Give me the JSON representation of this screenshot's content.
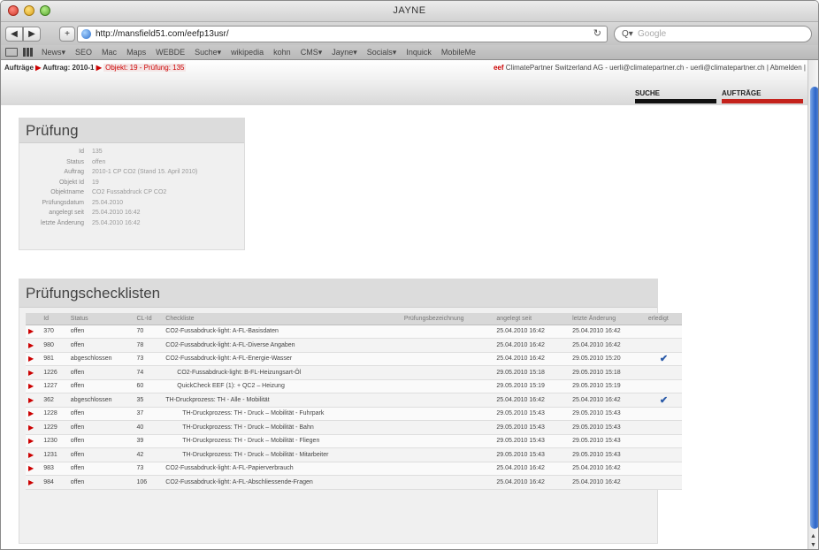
{
  "window": {
    "title": "JAYNE"
  },
  "browser": {
    "back_label": "◀",
    "forward_label": "▶",
    "add_label": "+",
    "url": "http://mansfield51.com/eefp13usr/",
    "reload_label": "↻",
    "search_placeholder": "Google",
    "search_icon": "Q▾",
    "bookmarks": [
      "News▾",
      "SEO",
      "Mac",
      "Maps",
      "WEBDE",
      "Suche▾",
      "wikipedia",
      "kohn",
      "CMS▾",
      "Jayne▾",
      "Socials▾",
      "Inquick",
      "MobileMe"
    ]
  },
  "header": {
    "crumb1": "Aufträge",
    "crumb2": "Auftrag: 2010-1",
    "crumb3": "Objekt: 19 - Prüfung: 135",
    "user_prefix": "eef",
    "user_text": "ClimatePartner Switzerland AG - uerli@climatepartner.ch - uerli@climatepartner.ch",
    "logout": "| Abmelden |",
    "nav_suche": "SUCHE",
    "nav_auftraege": "AUFTRÄGE"
  },
  "pruefung": {
    "title": "Prüfung",
    "rows": [
      {
        "label": "Id",
        "value": "135"
      },
      {
        "label": "Status",
        "value": "offen"
      },
      {
        "label": "Auftrag",
        "value": "2010-1  CP CO2 (Stand 15. April 2010)"
      },
      {
        "label": "Objekt Id",
        "value": "19"
      },
      {
        "label": "Objektname",
        "value": "CO2 Fussabdruck CP CO2"
      },
      {
        "label": "Prüfungsdatum",
        "value": "25.04.2010"
      },
      {
        "label": "angelegt seit",
        "value": "25.04.2010 16:42"
      },
      {
        "label": "letzte Änderung",
        "value": "25.04.2010 16:42"
      }
    ]
  },
  "checklists": {
    "title": "Prüfungschecklisten",
    "columns": [
      "",
      "Id",
      "Status",
      "CL-Id",
      "Checkliste",
      "Prüfungsbezeichnung",
      "angelegt seit",
      "letzte Änderung",
      "erledigt"
    ],
    "rows": [
      {
        "id": "370",
        "status": "offen",
        "clid": "70",
        "name": "CO2-Fussabdruck-light: A-FL-Basisdaten",
        "indent": 0,
        "created": "25.04.2010 16:42",
        "changed": "25.04.2010 16:42",
        "done": ""
      },
      {
        "id": "980",
        "status": "offen",
        "clid": "78",
        "name": "CO2-Fussabdruck-light: A-FL-Diverse Angaben",
        "indent": 0,
        "created": "25.04.2010 16:42",
        "changed": "25.04.2010 16:42",
        "done": ""
      },
      {
        "id": "981",
        "status": "abgeschlossen",
        "clid": "73",
        "name": "CO2-Fussabdruck-light: A-FL-Energie-Wasser",
        "indent": 0,
        "created": "25.04.2010 16:42",
        "changed": "29.05.2010 15:20",
        "done": "✔"
      },
      {
        "id": "1226",
        "status": "offen",
        "clid": "74",
        "name": "CO2-Fussabdruck-light: B-FL-Heizungsart-Öl",
        "indent": 1,
        "created": "29.05.2010 15:18",
        "changed": "29.05.2010 15:18",
        "done": ""
      },
      {
        "id": "1227",
        "status": "offen",
        "clid": "60",
        "name": "QuickCheck EEF (1): + QC2 – Heizung",
        "indent": 1,
        "created": "29.05.2010 15:19",
        "changed": "29.05.2010 15:19",
        "done": ""
      },
      {
        "id": "362",
        "status": "abgeschlossen",
        "clid": "35",
        "name": "TH-Druckprozess: TH - Alle - Mobilität",
        "indent": 0,
        "created": "25.04.2010 16:42",
        "changed": "25.04.2010 16:42",
        "done": "✔"
      },
      {
        "id": "1228",
        "status": "offen",
        "clid": "37",
        "name": "TH-Druckprozess: TH - Druck – Mobilität - Fuhrpark",
        "indent": 2,
        "created": "29.05.2010 15:43",
        "changed": "29.05.2010 15:43",
        "done": ""
      },
      {
        "id": "1229",
        "status": "offen",
        "clid": "40",
        "name": "TH-Druckprozess: TH - Druck – Mobilität - Bahn",
        "indent": 2,
        "created": "29.05.2010 15:43",
        "changed": "29.05.2010 15:43",
        "done": ""
      },
      {
        "id": "1230",
        "status": "offen",
        "clid": "39",
        "name": "TH-Druckprozess: TH - Druck – Mobilität - Fliegen",
        "indent": 2,
        "created": "29.05.2010 15:43",
        "changed": "29.05.2010 15:43",
        "done": ""
      },
      {
        "id": "1231",
        "status": "offen",
        "clid": "42",
        "name": "TH-Druckprozess: TH - Druck – Mobilität - Mitarbeiter",
        "indent": 2,
        "created": "29.05.2010 15:43",
        "changed": "29.05.2010 15:43",
        "done": ""
      },
      {
        "id": "983",
        "status": "offen",
        "clid": "73",
        "name": "CO2-Fussabdruck-light: A-FL-Papierverbrauch",
        "indent": 0,
        "created": "25.04.2010 16:42",
        "changed": "25.04.2010 16:42",
        "done": ""
      },
      {
        "id": "984",
        "status": "offen",
        "clid": "106",
        "name": "CO2-Fussabdruck-light: A-FL-Abschliessende-Fragen",
        "indent": 0,
        "created": "25.04.2010 16:42",
        "changed": "25.04.2010 16:42",
        "done": ""
      }
    ]
  },
  "colors": {
    "accent_red": "#c4221c",
    "check_blue": "#2a5aa8",
    "scroll_blue": "#2d66c8"
  }
}
